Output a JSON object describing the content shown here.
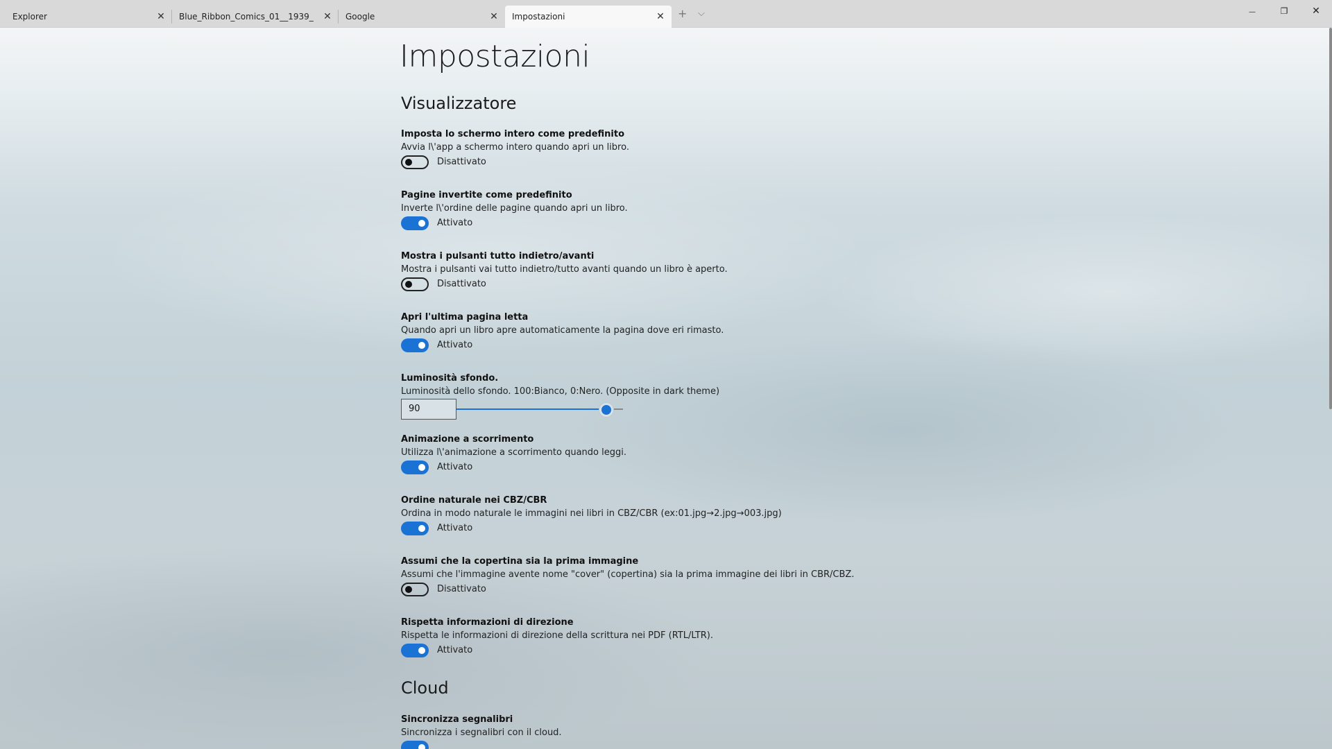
{
  "tabs": [
    {
      "label": "Explorer"
    },
    {
      "label": "Blue_Ribbon_Comics_01__1939_"
    },
    {
      "label": "Google"
    },
    {
      "label": "Impostazioni"
    }
  ],
  "titlebar": {
    "close_glyph": "✕",
    "add_icon": "plus-icon",
    "dropdown_icon": "chevron-down-icon",
    "minimize_glyph": "—",
    "restore_glyph": "❐",
    "window_close_glyph": "✕"
  },
  "page": {
    "title": "Impostazioni"
  },
  "sections": {
    "viewer": "Visualizzatore",
    "cloud": "Cloud"
  },
  "settings": [
    {
      "title": "Imposta lo schermo intero come predefinito",
      "desc": "Avvia l\\'app a schermo intero quando apri un libro.",
      "state": "Disattivato",
      "on": false
    },
    {
      "title": "Pagine invertite come predefinito",
      "desc": "Inverte l\\'ordine delle pagine quando apri un libro.",
      "state": "Attivato",
      "on": true
    },
    {
      "title": "Mostra i pulsanti tutto indietro/avanti",
      "desc": "Mostra i pulsanti vai tutto indietro/tutto avanti quando un libro è aperto.",
      "state": "Disattivato",
      "on": false
    },
    {
      "title": "Apri l'ultima pagina letta",
      "desc": "Quando apri un libro apre automaticamente la pagina dove eri rimasto.",
      "state": "Attivato",
      "on": true
    },
    {
      "title": "Luminosità sfondo.",
      "desc": "Luminosità dello sfondo. 100:Bianco, 0:Nero. (Opposite in dark theme)",
      "value": "90",
      "slider_fraction": 0.9
    },
    {
      "title": "Animazione a scorrimento",
      "desc": "Utilizza l\\'animazione a scorrimento quando leggi.",
      "state": "Attivato",
      "on": true
    },
    {
      "title": "Ordine naturale nei CBZ/CBR",
      "desc": "Ordina in modo naturale le immagini nei libri in CBZ/CBR (ex:01.jpg→2.jpg→003.jpg)",
      "state": "Attivato",
      "on": true
    },
    {
      "title": "Assumi che la copertina sia la prima immagine",
      "desc": "Assumi che l'immagine avente nome \"cover\" (copertina) sia la prima immagine dei libri in CBR/CBZ.",
      "state": "Disattivato",
      "on": false
    },
    {
      "title": "Rispetta informazioni di direzione",
      "desc": "Rispetta le informazioni di direzione della scrittura nei PDF (RTL/LTR).",
      "state": "Attivato",
      "on": true
    }
  ],
  "cloud": {
    "title": "Sincronizza segnalibri",
    "desc": "Sincronizza i segnalibri con il cloud.",
    "on": true
  },
  "colors": {
    "accent": "#1a73d4"
  }
}
